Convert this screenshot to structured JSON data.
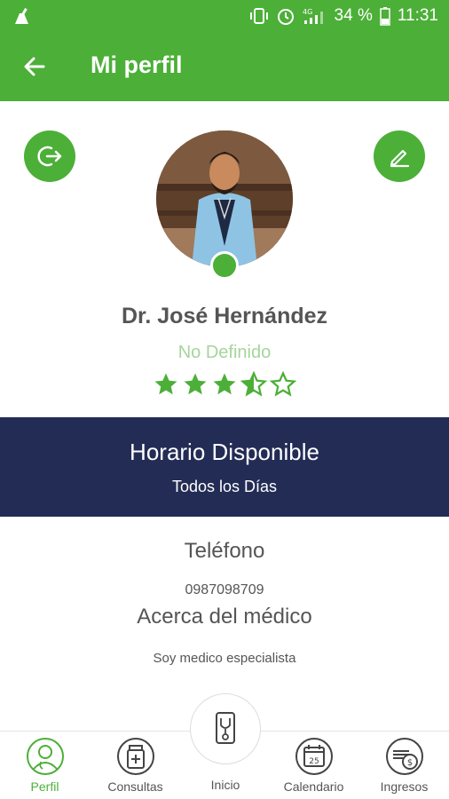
{
  "status_bar": {
    "network": "4G",
    "battery": "34 %",
    "time": "11:31"
  },
  "app_bar": {
    "title": "Mi perfil"
  },
  "profile": {
    "name": "Dr. José Hernández",
    "specialty": "No Definido",
    "rating": 3.5,
    "rating_max": 5
  },
  "schedule": {
    "title": "Horario Disponible",
    "days": "Todos los Días"
  },
  "info": {
    "phone_label": "Teléfono",
    "phone_value": "0987098709",
    "about_label": "Acerca del médico",
    "about_value": "Soy medico especialista"
  },
  "bottom_nav": {
    "items": [
      {
        "label": "Perfil",
        "icon": "doctor-icon",
        "active": true
      },
      {
        "label": "Consultas",
        "icon": "medicine-icon",
        "active": false
      },
      {
        "label": "Inicio",
        "icon": "phone-stethoscope-icon",
        "active": false
      },
      {
        "label": "Calendario",
        "icon": "calendar-icon",
        "active": false,
        "badge": "25"
      },
      {
        "label": "Ingresos",
        "icon": "money-icon",
        "active": false
      }
    ]
  },
  "colors": {
    "primary": "#4caf38",
    "navy": "#232c55",
    "specialty": "#a5d59b"
  }
}
